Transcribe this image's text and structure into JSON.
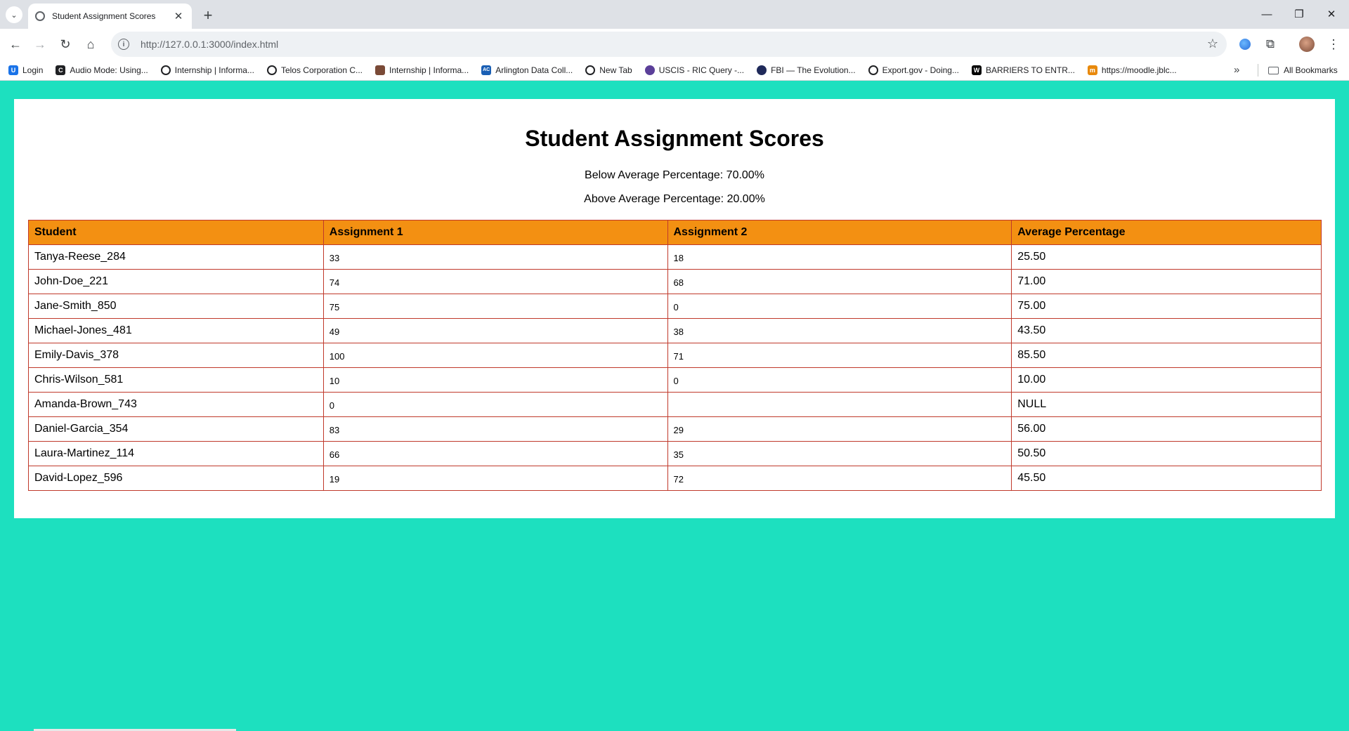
{
  "browser": {
    "tab_title": "Student Assignment Scores",
    "url": "http://127.0.0.1:3000/index.html",
    "bookmarks": [
      {
        "label": "Login",
        "icon": "login-favicon",
        "color": "#1a73e8"
      },
      {
        "label": "Audio Mode: Using...",
        "icon": "audio-favicon",
        "color": "#202124"
      },
      {
        "label": "Internship | Informa...",
        "icon": "globe-icon",
        "color": "#202124"
      },
      {
        "label": "Telos Corporation C...",
        "icon": "globe-icon",
        "color": "#202124"
      },
      {
        "label": "Internship | Informa...",
        "icon": "briefcase-icon",
        "color": "#7a4a37"
      },
      {
        "label": "Arlington Data Coll...",
        "icon": "arlington-favicon",
        "color": "#1a5fb4"
      },
      {
        "label": "New Tab",
        "icon": "globe-icon",
        "color": "#202124"
      },
      {
        "label": "USCIS - RIC Query -...",
        "icon": "uscis-favicon",
        "color": "#5b3f99"
      },
      {
        "label": "FBI — The Evolution...",
        "icon": "fbi-favicon",
        "color": "#1f2a5a"
      },
      {
        "label": "Export.gov - Doing...",
        "icon": "globe-icon",
        "color": "#202124"
      },
      {
        "label": "BARRIERS TO ENTR...",
        "icon": "w-favicon",
        "color": "#000000"
      },
      {
        "label": "https://moodle.jblc...",
        "icon": "moodle-favicon",
        "color": "#e8890c"
      }
    ],
    "all_bookmarks_label": "All Bookmarks"
  },
  "page": {
    "title": "Student Assignment Scores",
    "below_average": "Below Average Percentage: 70.00%",
    "above_average": "Above Average Percentage: 20.00%",
    "background_color": "#1de0bf",
    "header_color": "#f39012",
    "border_color": "#c0392b"
  },
  "table": {
    "headers": [
      "Student",
      "Assignment 1",
      "Assignment 2",
      "Average Percentage"
    ],
    "rows": [
      [
        "Tanya-Reese_284",
        "33",
        "18",
        "25.50"
      ],
      [
        "John-Doe_221",
        "74",
        "68",
        "71.00"
      ],
      [
        "Jane-Smith_850",
        "75",
        "0",
        "75.00"
      ],
      [
        "Michael-Jones_481",
        "49",
        "38",
        "43.50"
      ],
      [
        "Emily-Davis_378",
        "100",
        "71",
        "85.50"
      ],
      [
        "Chris-Wilson_581",
        "10",
        "0",
        "10.00"
      ],
      [
        "Amanda-Brown_743",
        "0",
        "",
        "NULL"
      ],
      [
        "Daniel-Garcia_354",
        "83",
        "29",
        "56.00"
      ],
      [
        "Laura-Martinez_114",
        "66",
        "35",
        "50.50"
      ],
      [
        "David-Lopez_596",
        "19",
        "72",
        "45.50"
      ]
    ]
  }
}
